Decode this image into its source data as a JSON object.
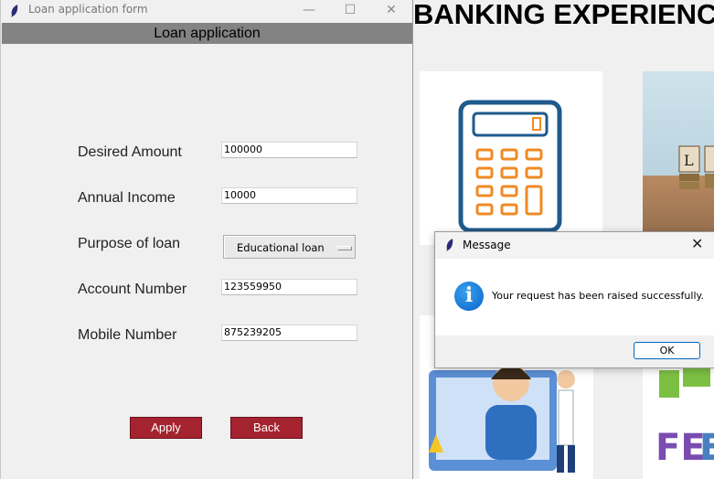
{
  "background_app": {
    "heading": "BANKING EXPERIENC"
  },
  "loan_window": {
    "title": "Loan application form",
    "header": "Loan application",
    "fields": {
      "desired_amount": {
        "label": "Desired Amount",
        "value": "100000"
      },
      "annual_income": {
        "label": "Annual Income",
        "value": "10000"
      },
      "purpose": {
        "label": "Purpose of loan",
        "selected": "Educational loan"
      },
      "account_number": {
        "label": "Account Number",
        "value": "123559950"
      },
      "mobile_number": {
        "label": "Mobile Number",
        "value": "875239205"
      }
    },
    "buttons": {
      "apply": "Apply",
      "back": "Back"
    }
  },
  "message_dialog": {
    "title": "Message",
    "message": "Your request has been raised successfully.",
    "ok_label": "OK",
    "icon": "info-icon"
  },
  "colors": {
    "accent_button": "#a4232f",
    "header_bar": "#838383",
    "info_blue": "#0a64c8"
  }
}
